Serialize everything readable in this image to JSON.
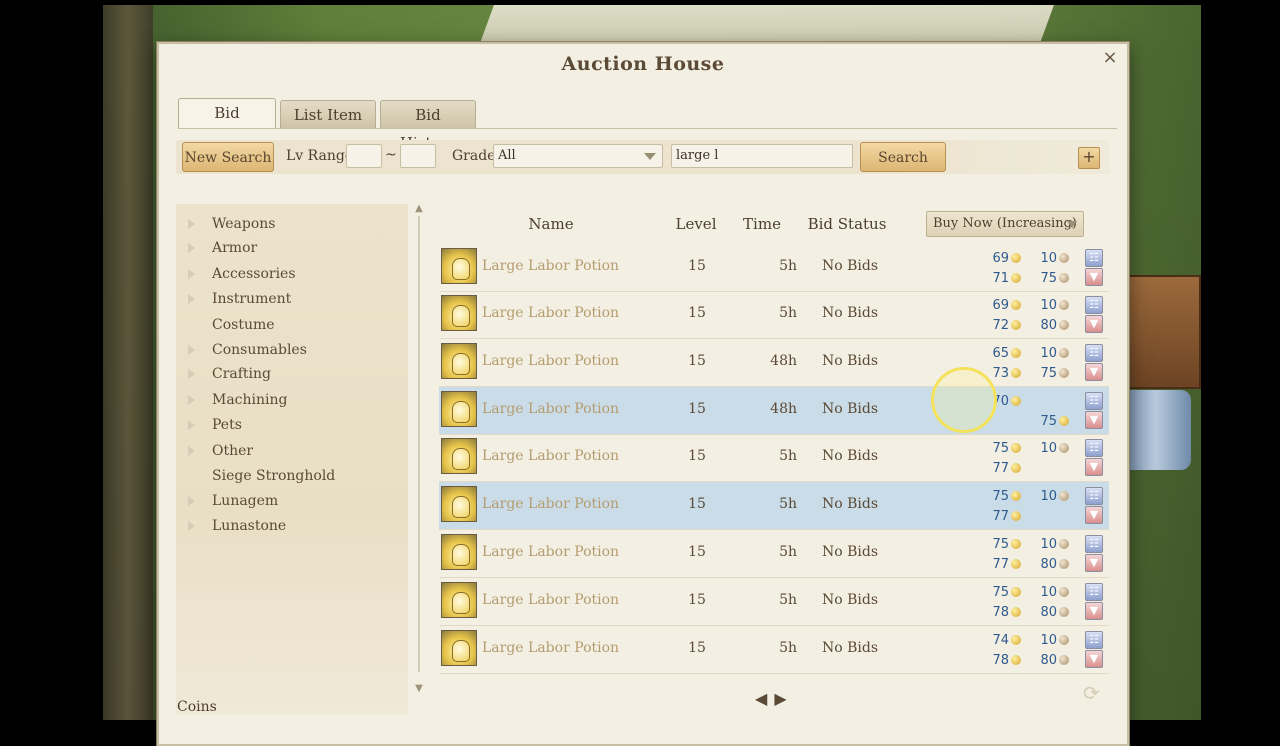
{
  "window": {
    "title": "Auction House",
    "close_icon": "×"
  },
  "tabs": [
    {
      "label": "Bid",
      "active": true
    },
    {
      "label": "List Item",
      "active": false
    },
    {
      "label": "Bid History",
      "active": false
    }
  ],
  "search": {
    "new_search_label": "New Search",
    "lv_range_label": "Lv Range",
    "lv_min": "",
    "lv_max": "",
    "range_sep": "~",
    "grade_label": "Grade",
    "grade_value": "All",
    "query": "large l",
    "search_label": "Search",
    "plus_label": "+"
  },
  "categories": [
    {
      "label": "Weapons",
      "expandable": true
    },
    {
      "label": "Armor",
      "expandable": true
    },
    {
      "label": "Accessories",
      "expandable": true
    },
    {
      "label": "Instrument",
      "expandable": true
    },
    {
      "label": "Costume",
      "expandable": false
    },
    {
      "label": "Consumables",
      "expandable": true
    },
    {
      "label": "Crafting",
      "expandable": true
    },
    {
      "label": "Machining",
      "expandable": true
    },
    {
      "label": "Pets",
      "expandable": true
    },
    {
      "label": "Other",
      "expandable": true
    },
    {
      "label": "Siege Stronghold",
      "expandable": false
    },
    {
      "label": "Lunagem",
      "expandable": true
    },
    {
      "label": "Lunastone",
      "expandable": true
    }
  ],
  "columns": {
    "name": "Name",
    "level": "Level",
    "time": "Time",
    "bid_status": "Bid Status",
    "sort": "Buy Now (Increasing)"
  },
  "listings": [
    {
      "name": "Large Labor Potion",
      "level": "15",
      "time": "5h",
      "status": "No Bids",
      "highlight": false,
      "bid_gold": "69",
      "bid_silver": "10",
      "buy_gold": "71",
      "buy_silver": "75"
    },
    {
      "name": "Large Labor Potion",
      "level": "15",
      "time": "5h",
      "status": "No Bids",
      "highlight": false,
      "bid_gold": "69",
      "bid_silver": "10",
      "buy_gold": "72",
      "buy_silver": "80"
    },
    {
      "name": "Large Labor Potion",
      "level": "15",
      "time": "48h",
      "status": "No Bids",
      "highlight": false,
      "bid_gold": "65",
      "bid_silver": "10",
      "buy_gold": "73",
      "buy_silver": "75"
    },
    {
      "name": "Large Labor Potion",
      "level": "15",
      "time": "48h",
      "status": "No Bids",
      "highlight": true,
      "bid_gold": "70",
      "bid_silver": "",
      "buy_gold": "75",
      "buy_silver": ""
    },
    {
      "name": "Large Labor Potion",
      "level": "15",
      "time": "5h",
      "status": "No Bids",
      "highlight": false,
      "bid_gold": "75",
      "bid_silver": "10",
      "buy_gold": "77",
      "buy_silver": ""
    },
    {
      "name": "Large Labor Potion",
      "level": "15",
      "time": "5h",
      "status": "No Bids",
      "highlight": true,
      "bid_gold": "75",
      "bid_silver": "10",
      "buy_gold": "77",
      "buy_silver": ""
    },
    {
      "name": "Large Labor Potion",
      "level": "15",
      "time": "5h",
      "status": "No Bids",
      "highlight": false,
      "bid_gold": "75",
      "bid_silver": "10",
      "buy_gold": "77",
      "buy_silver": "80"
    },
    {
      "name": "Large Labor Potion",
      "level": "15",
      "time": "5h",
      "status": "No Bids",
      "highlight": false,
      "bid_gold": "75",
      "bid_silver": "10",
      "buy_gold": "78",
      "buy_silver": "80"
    },
    {
      "name": "Large Labor Potion",
      "level": "15",
      "time": "5h",
      "status": "No Bids",
      "highlight": false,
      "bid_gold": "74",
      "bid_silver": "10",
      "buy_gold": "78",
      "buy_silver": "80"
    }
  ],
  "pager": {
    "prev_icon": "◀",
    "next_icon": "▶"
  },
  "footer": {
    "coins_label": "Coins",
    "refresh_icon": "⟳"
  },
  "colors": {
    "highlight_row": "#c9dce8",
    "price_text": "#2f5a8e",
    "button_gold": "#dcb574"
  }
}
